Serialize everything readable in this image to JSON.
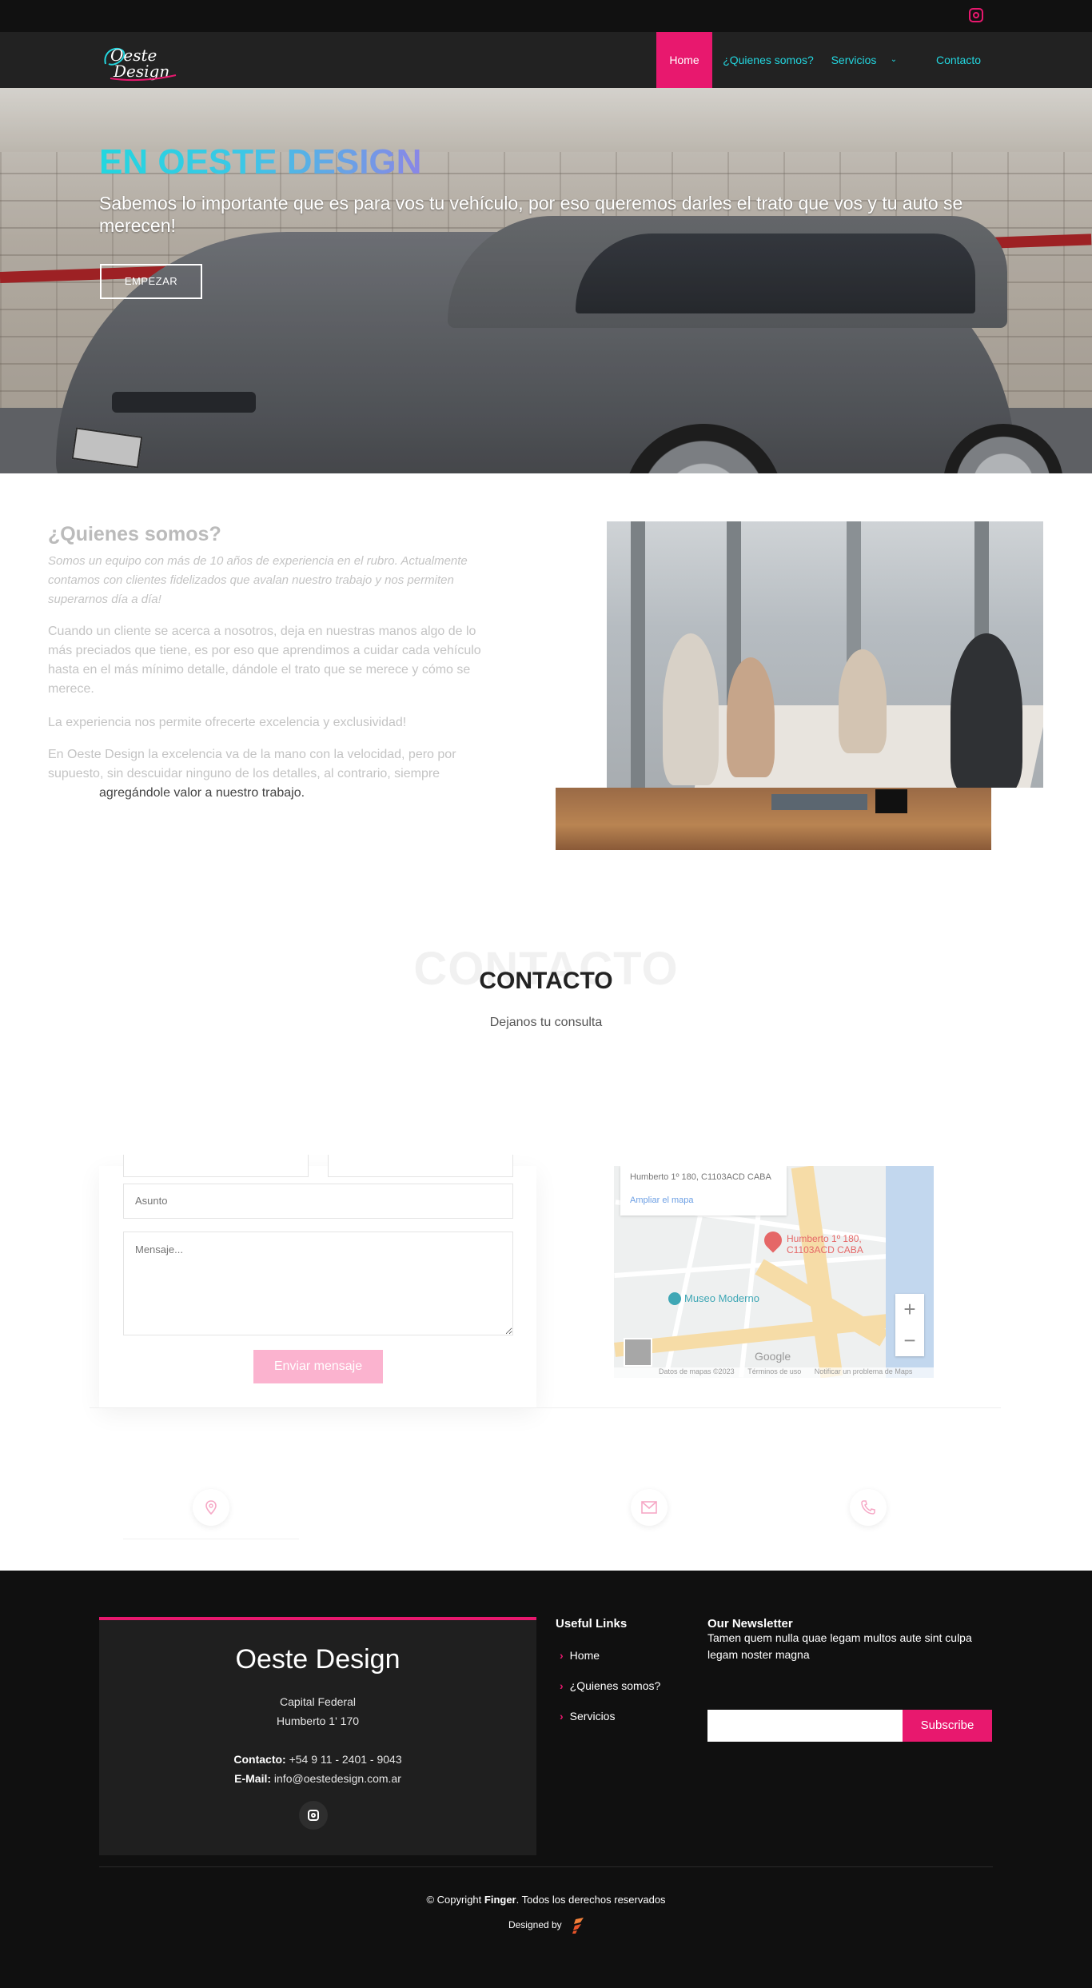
{
  "header": {
    "logo_alt": "Oeste Design",
    "nav": [
      {
        "label": "Home",
        "active": true
      },
      {
        "label": "¿Quienes somos?"
      },
      {
        "label": "Servicios",
        "has_dropdown": true
      },
      {
        "label": "Contacto"
      }
    ]
  },
  "hero": {
    "title": "EN OESTE DESIGN",
    "subtitle": "Sabemos lo importante que es para vos tu vehículo, por eso queremos darles el trato que vos y tu auto se merecen!",
    "button": "EMPEZAR"
  },
  "about": {
    "title": "¿Quienes somos?",
    "intro": "Somos un equipo con más de 10 años de experiencia en el rubro. Actualmente contamos con clientes fidelizados que avalan nuestro trabajo y nos permiten superarnos día a día!",
    "p1": "Cuando un cliente se acerca a nosotros, deja en nuestras manos algo de lo más preciados que tiene, es por eso que aprendimos a cuidar cada vehículo hasta en el más mínimo detalle, dándole el trato que se merece y cómo se merece.",
    "p2": "La experiencia nos permite ofrecerte excelencia y exclusividad!",
    "p3": "En Oeste Design la excelencia va de la mano con la velocidad, pero por supuesto, sin descuidar ninguno de los detalles, al contrario, siempre",
    "p4": "agregándole valor a nuestro trabajo."
  },
  "contact": {
    "ghost_title": "CONTACTO",
    "title": "CONTACTO",
    "subtitle": "Dejanos tu consulta",
    "form": {
      "subject_placeholder": "Asunto",
      "message_placeholder": "Mensaje...",
      "submit": "Enviar mensaje"
    },
    "map": {
      "address": "Humberto 1º 180, C1103ACD CABA",
      "enlarge": "Ampliar el mapa",
      "pin_label_1": "Humberto 1º 180,",
      "pin_label_2": "C1103ACD CABA",
      "poi": "Museo Moderno",
      "zoom_in": "+",
      "zoom_out": "−",
      "google": "Google",
      "credits": [
        "Datos de mapas ©2023",
        "Términos de uso",
        "Notificar un problema de Maps"
      ]
    }
  },
  "footer": {
    "brand": "Oeste Design",
    "city": "Capital Federal",
    "street": "Humberto 1' 170",
    "contact_label": "Contacto:",
    "contact_value": "+54 9 11 - 2401 - 9043",
    "email_label": "E-Mail:",
    "email_value": "info@oestedesign.com.ar",
    "useful_title": "Useful Links",
    "useful_links": [
      "Home",
      "¿Quienes somos?",
      "Servicios"
    ],
    "newsletter_title": "Our Newsletter",
    "newsletter_text": "Tamen quem nulla quae legam multos aute sint culpa legam noster magna",
    "subscribe": "Subscribe",
    "copyright_prefix": "© Copyright ",
    "copyright_brand": "Finger",
    "copyright_suffix": ". Todos los derechos reservados",
    "designed_by": "Designed by"
  },
  "colors": {
    "accent": "#e8186e",
    "nav_text": "#23d6df",
    "footer_bg": "#101010"
  }
}
